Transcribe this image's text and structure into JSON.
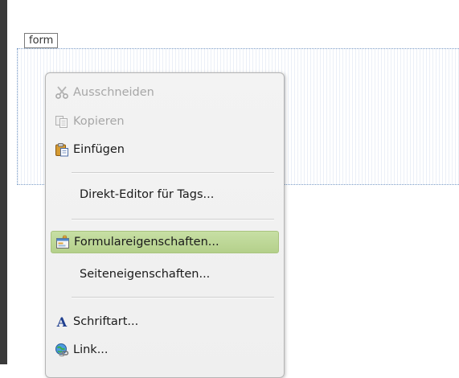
{
  "form_tag": {
    "label": "form"
  },
  "context_menu": {
    "items": [
      {
        "label": "Ausschneiden",
        "icon": "scissors-icon",
        "enabled": false
      },
      {
        "label": "Kopieren",
        "icon": "copy-icon",
        "enabled": false
      },
      {
        "label": "Einfügen",
        "icon": "paste-icon",
        "enabled": true
      },
      {
        "label": "Direkt-Editor für Tags...",
        "enabled": true
      },
      {
        "label": "Formulareigenschaften...",
        "icon": "form-properties-icon",
        "enabled": true,
        "highlighted": true
      },
      {
        "label": "Seiteneigenschaften...",
        "enabled": true
      },
      {
        "label": "Schriftart...",
        "icon": "font-icon",
        "icon_glyph": "A",
        "enabled": true
      },
      {
        "label": "Link...",
        "icon": "link-icon",
        "enabled": true
      }
    ]
  },
  "colors": {
    "highlight": "#b9d490",
    "disabled_text": "#a7a7a7",
    "menu_background": "#f0f0f0"
  }
}
